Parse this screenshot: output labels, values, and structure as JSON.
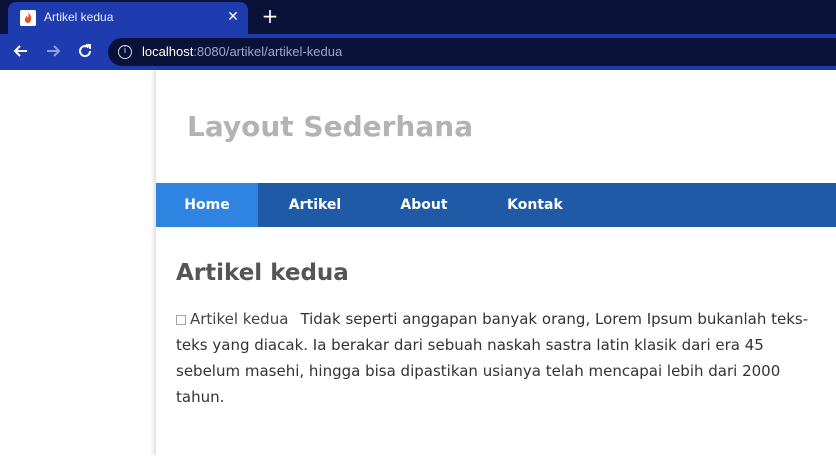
{
  "browser": {
    "tab_title": "Artikel kedua",
    "tab_close": "✕",
    "new_tab": "+",
    "url_host": "localhost",
    "url_rest": ":8080/artikel/artikel-kedua",
    "icons": {
      "back": "arrow-left-icon",
      "forward": "arrow-right-icon",
      "reload": "reload-icon",
      "info": "info-icon",
      "favicon": "flame-icon"
    }
  },
  "site": {
    "title": "Layout Sederhana",
    "nav": [
      "Home",
      "Artikel",
      "About",
      "Kontak"
    ]
  },
  "article": {
    "title": "Artikel kedua",
    "image_alt": "Artikel kedua",
    "body": "Tidak seperti anggapan banyak orang, Lorem Ipsum bukanlah teks-teks yang diacak. Ia berakar dari sebuah naskah sastra latin klasik dari era 45 sebelum masehi, hingga bisa dipastikan usianya telah mencapai lebih dari 2000 tahun."
  },
  "colors": {
    "chrome_dark": "#0b1238",
    "chrome_blue": "#1e3bb0",
    "nav_bg": "#1e5aa6",
    "nav_active": "#2e84e0"
  }
}
